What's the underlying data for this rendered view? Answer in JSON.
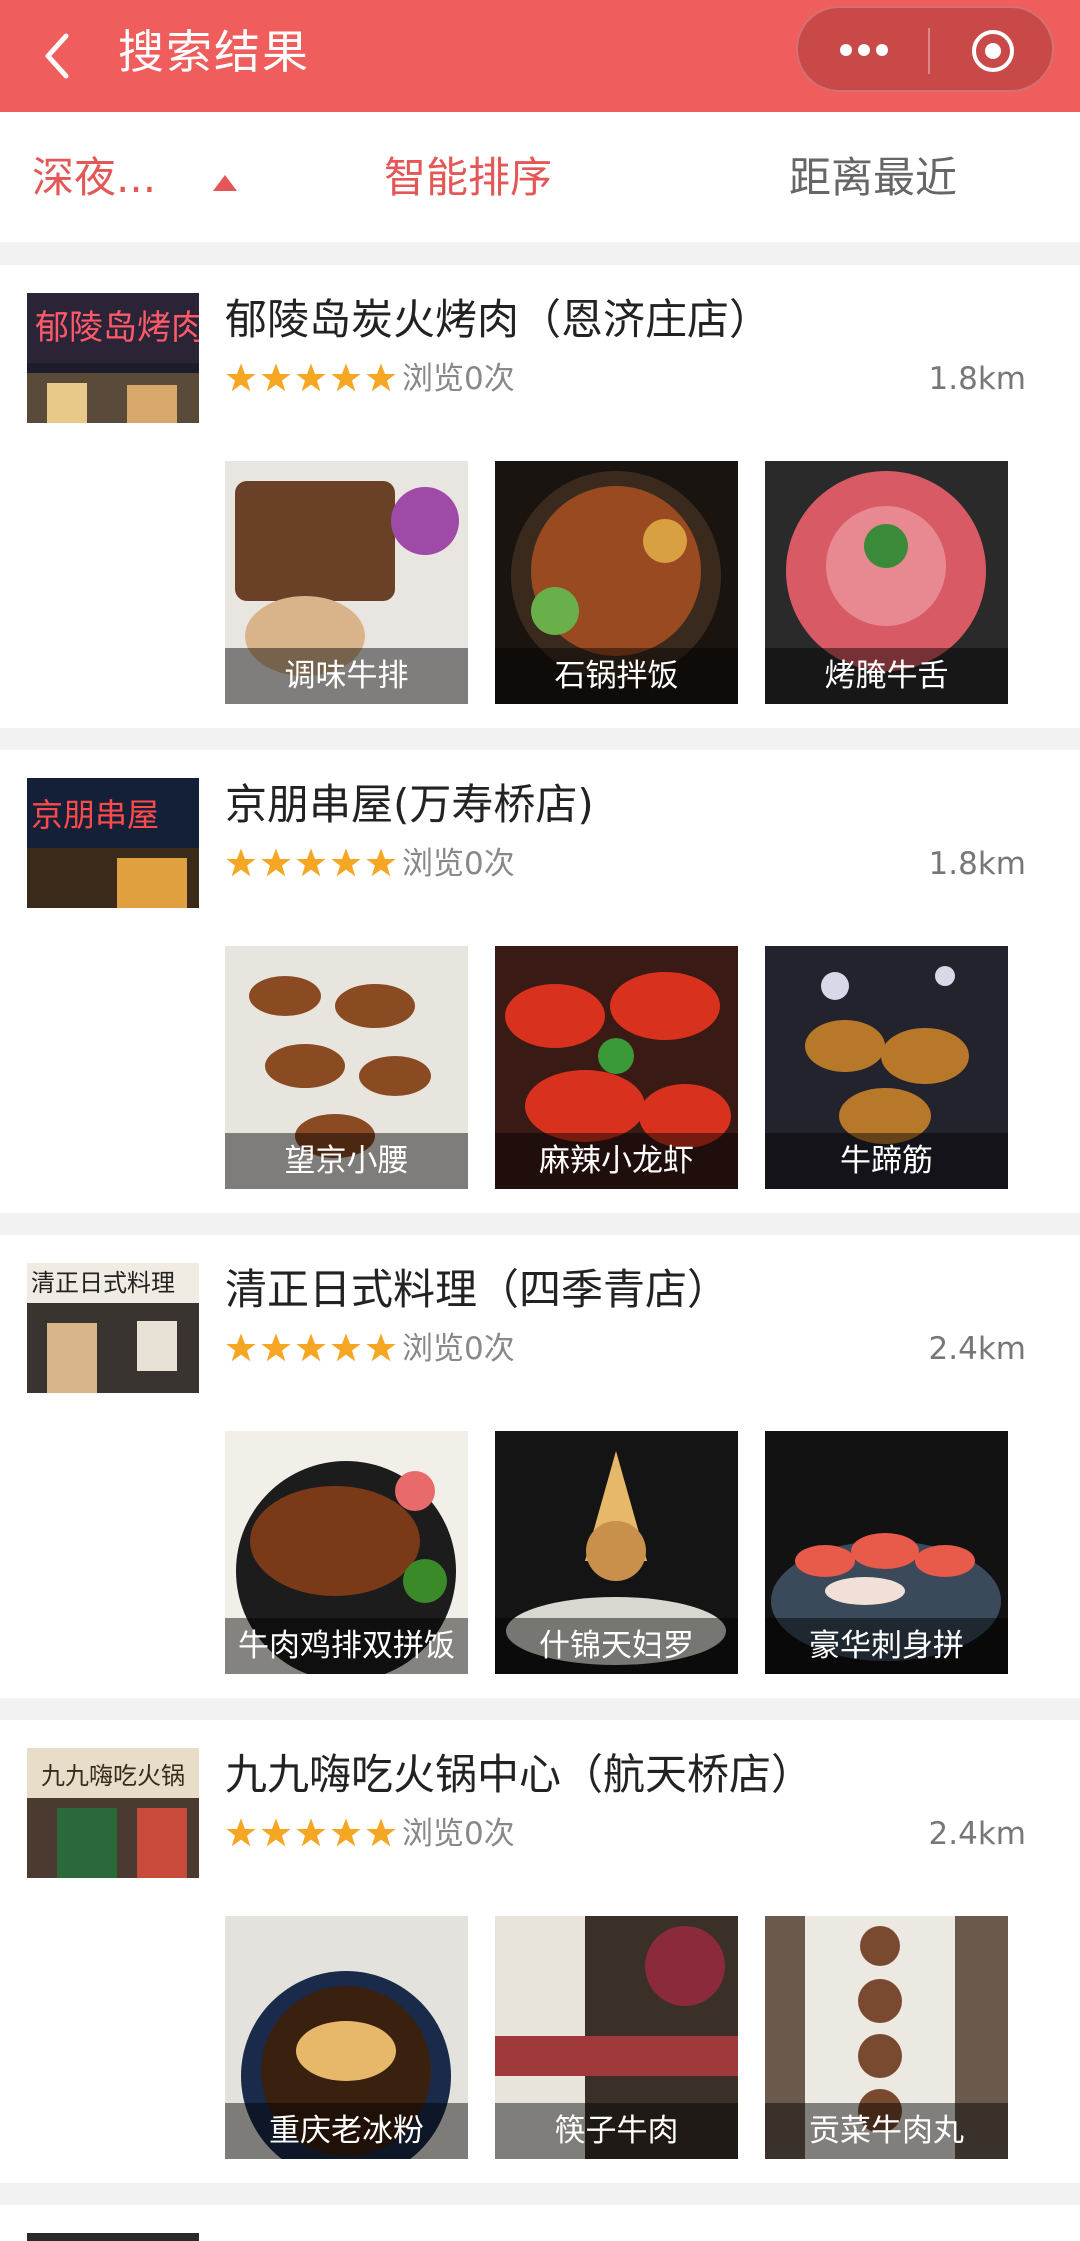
{
  "header": {
    "title": "搜索结果"
  },
  "filters": {
    "late_night": "深夜...",
    "smart_sort": "智能排序",
    "nearest": "距离最近"
  },
  "stars": 5,
  "restaurants": [
    {
      "name": "郁陵岛炭火烤肉（恩济庄店）",
      "views": "浏览0次",
      "distance": "1.8km",
      "sign_text": "郁陵岛烤肉",
      "dishes": [
        {
          "label": "调味牛排"
        },
        {
          "label": "石锅拌饭"
        },
        {
          "label": "烤腌牛舌"
        }
      ]
    },
    {
      "name": "京朋串屋(万寿桥店)",
      "views": "浏览0次",
      "distance": "1.8km",
      "sign_text": "京朋串屋",
      "dishes": [
        {
          "label": "望京小腰"
        },
        {
          "label": "麻辣小龙虾"
        },
        {
          "label": "牛蹄筋"
        }
      ]
    },
    {
      "name": "清正日式料理（四季青店）",
      "views": "浏览0次",
      "distance": "2.4km",
      "sign_text": "清正日式料理",
      "dishes": [
        {
          "label": "牛肉鸡排双拼饭"
        },
        {
          "label": "什锦天妇罗"
        },
        {
          "label": "豪华刺身拼"
        }
      ]
    },
    {
      "name": "九九嗨吃火锅中心（航天桥店）",
      "views": "浏览0次",
      "distance": "2.4km",
      "sign_text": "九九嗨吃火锅",
      "dishes": [
        {
          "label": "重庆老冰粉"
        },
        {
          "label": "筷子牛肉"
        },
        {
          "label": "贡菜牛肉丸"
        }
      ]
    }
  ]
}
